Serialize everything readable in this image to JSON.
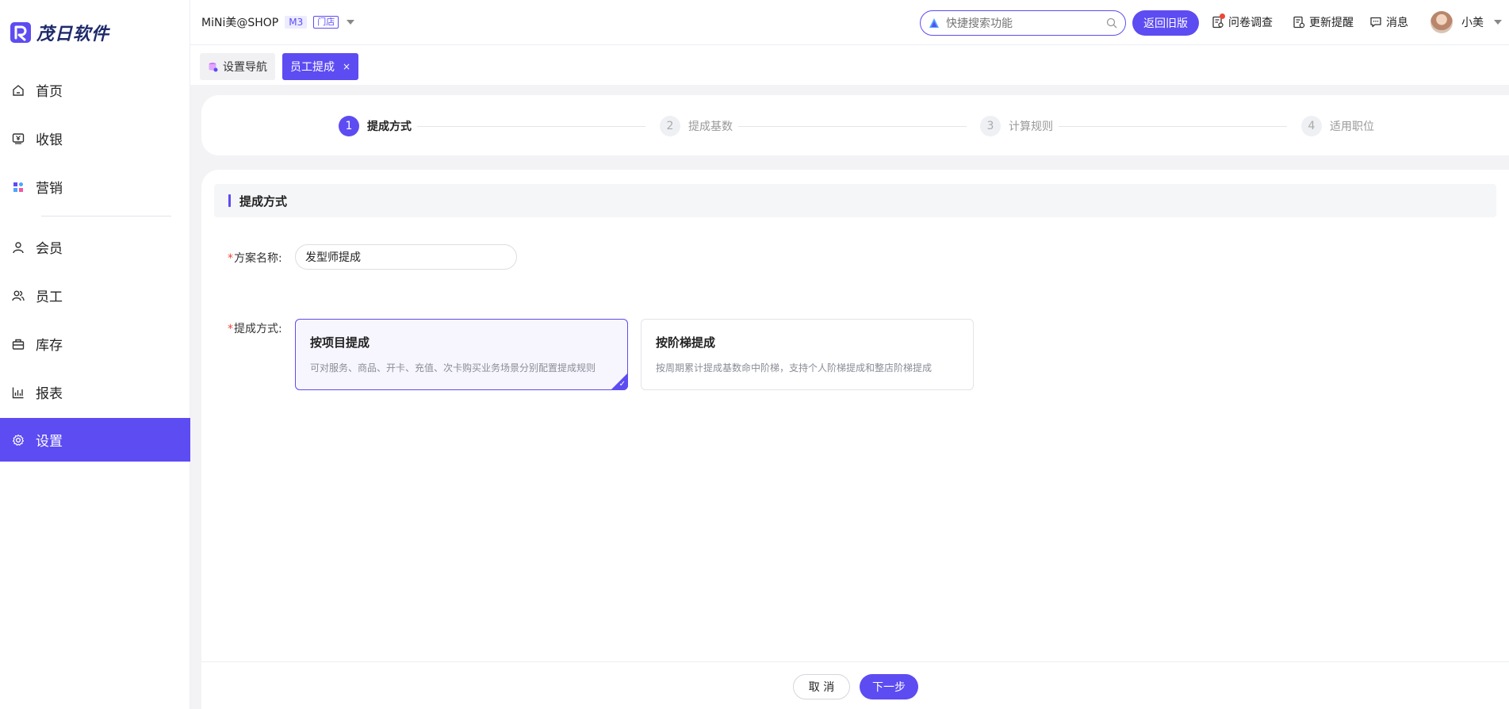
{
  "brand": {
    "name": "茂日软件"
  },
  "sidebar": {
    "items": [
      {
        "label": "首页",
        "icon": "home-icon"
      },
      {
        "label": "收银",
        "icon": "cashier-icon"
      },
      {
        "label": "营销",
        "icon": "marketing-icon"
      },
      {
        "label": "会员",
        "icon": "member-icon"
      },
      {
        "label": "员工",
        "icon": "staff-icon"
      },
      {
        "label": "库存",
        "icon": "inventory-icon"
      },
      {
        "label": "报表",
        "icon": "report-icon"
      },
      {
        "label": "设置",
        "icon": "gear-icon",
        "active": true
      }
    ]
  },
  "header": {
    "shop_name": "MiNi美@SHOP",
    "plan_tag": "M3",
    "store_tag": "门店",
    "search_placeholder": "快捷搜索功能",
    "back_old_label": "返回旧版",
    "survey_label": "问卷调查",
    "updates_label": "更新提醒",
    "messages_label": "消息",
    "user_name": "小美"
  },
  "tabs": [
    {
      "label": "设置导航",
      "active": false
    },
    {
      "label": "员工提成",
      "active": true,
      "close": "×"
    }
  ],
  "steps": [
    {
      "num": "1",
      "label": "提成方式",
      "active": true
    },
    {
      "num": "2",
      "label": "提成基数",
      "active": false
    },
    {
      "num": "3",
      "label": "计算规则",
      "active": false
    },
    {
      "num": "4",
      "label": "适用职位",
      "active": false
    }
  ],
  "form": {
    "section_title": "提成方式",
    "required_mark": "*",
    "name_label": "方案名称:",
    "name_value": "发型师提成",
    "method_label": "提成方式:",
    "options": [
      {
        "title": "按项目提成",
        "desc": "可对服务、商品、开卡、充值、次卡购买业务场景分别配置提成规则",
        "selected": true
      },
      {
        "title": "按阶梯提成",
        "desc": "按周期累计提成基数命中阶梯，支持个人阶梯提成和整店阶梯提成",
        "selected": false
      }
    ]
  },
  "footer": {
    "cancel_label": "取 消",
    "next_label": "下一步"
  },
  "colors": {
    "accent": "#5d4cf2",
    "required": "#f0453a"
  }
}
